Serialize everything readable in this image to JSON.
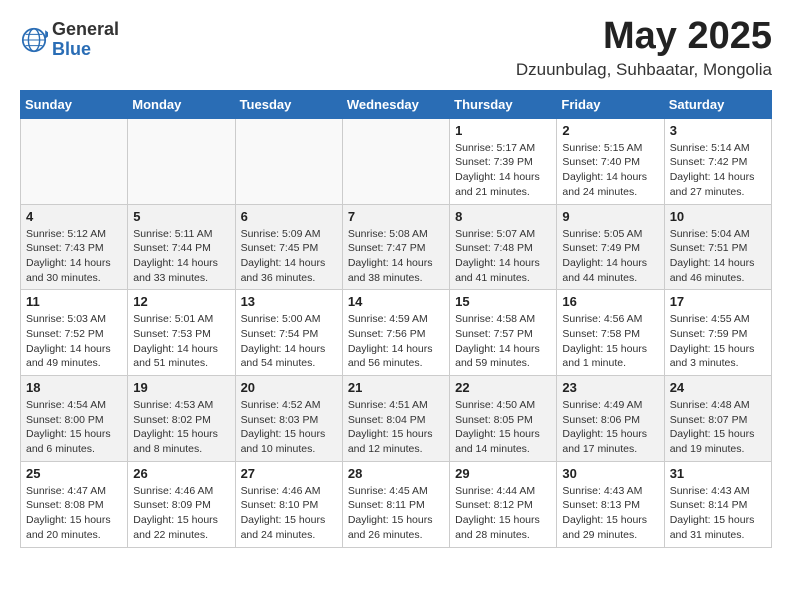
{
  "logo": {
    "general": "General",
    "blue": "Blue"
  },
  "title": "May 2025",
  "location": "Dzuunbulag, Suhbaatar, Mongolia",
  "days_of_week": [
    "Sunday",
    "Monday",
    "Tuesday",
    "Wednesday",
    "Thursday",
    "Friday",
    "Saturday"
  ],
  "weeks": [
    [
      {
        "day": "",
        "info": ""
      },
      {
        "day": "",
        "info": ""
      },
      {
        "day": "",
        "info": ""
      },
      {
        "day": "",
        "info": ""
      },
      {
        "day": "1",
        "info": "Sunrise: 5:17 AM\nSunset: 7:39 PM\nDaylight: 14 hours\nand 21 minutes."
      },
      {
        "day": "2",
        "info": "Sunrise: 5:15 AM\nSunset: 7:40 PM\nDaylight: 14 hours\nand 24 minutes."
      },
      {
        "day": "3",
        "info": "Sunrise: 5:14 AM\nSunset: 7:42 PM\nDaylight: 14 hours\nand 27 minutes."
      }
    ],
    [
      {
        "day": "4",
        "info": "Sunrise: 5:12 AM\nSunset: 7:43 PM\nDaylight: 14 hours\nand 30 minutes."
      },
      {
        "day": "5",
        "info": "Sunrise: 5:11 AM\nSunset: 7:44 PM\nDaylight: 14 hours\nand 33 minutes."
      },
      {
        "day": "6",
        "info": "Sunrise: 5:09 AM\nSunset: 7:45 PM\nDaylight: 14 hours\nand 36 minutes."
      },
      {
        "day": "7",
        "info": "Sunrise: 5:08 AM\nSunset: 7:47 PM\nDaylight: 14 hours\nand 38 minutes."
      },
      {
        "day": "8",
        "info": "Sunrise: 5:07 AM\nSunset: 7:48 PM\nDaylight: 14 hours\nand 41 minutes."
      },
      {
        "day": "9",
        "info": "Sunrise: 5:05 AM\nSunset: 7:49 PM\nDaylight: 14 hours\nand 44 minutes."
      },
      {
        "day": "10",
        "info": "Sunrise: 5:04 AM\nSunset: 7:51 PM\nDaylight: 14 hours\nand 46 minutes."
      }
    ],
    [
      {
        "day": "11",
        "info": "Sunrise: 5:03 AM\nSunset: 7:52 PM\nDaylight: 14 hours\nand 49 minutes."
      },
      {
        "day": "12",
        "info": "Sunrise: 5:01 AM\nSunset: 7:53 PM\nDaylight: 14 hours\nand 51 minutes."
      },
      {
        "day": "13",
        "info": "Sunrise: 5:00 AM\nSunset: 7:54 PM\nDaylight: 14 hours\nand 54 minutes."
      },
      {
        "day": "14",
        "info": "Sunrise: 4:59 AM\nSunset: 7:56 PM\nDaylight: 14 hours\nand 56 minutes."
      },
      {
        "day": "15",
        "info": "Sunrise: 4:58 AM\nSunset: 7:57 PM\nDaylight: 14 hours\nand 59 minutes."
      },
      {
        "day": "16",
        "info": "Sunrise: 4:56 AM\nSunset: 7:58 PM\nDaylight: 15 hours\nand 1 minute."
      },
      {
        "day": "17",
        "info": "Sunrise: 4:55 AM\nSunset: 7:59 PM\nDaylight: 15 hours\nand 3 minutes."
      }
    ],
    [
      {
        "day": "18",
        "info": "Sunrise: 4:54 AM\nSunset: 8:00 PM\nDaylight: 15 hours\nand 6 minutes."
      },
      {
        "day": "19",
        "info": "Sunrise: 4:53 AM\nSunset: 8:02 PM\nDaylight: 15 hours\nand 8 minutes."
      },
      {
        "day": "20",
        "info": "Sunrise: 4:52 AM\nSunset: 8:03 PM\nDaylight: 15 hours\nand 10 minutes."
      },
      {
        "day": "21",
        "info": "Sunrise: 4:51 AM\nSunset: 8:04 PM\nDaylight: 15 hours\nand 12 minutes."
      },
      {
        "day": "22",
        "info": "Sunrise: 4:50 AM\nSunset: 8:05 PM\nDaylight: 15 hours\nand 14 minutes."
      },
      {
        "day": "23",
        "info": "Sunrise: 4:49 AM\nSunset: 8:06 PM\nDaylight: 15 hours\nand 17 minutes."
      },
      {
        "day": "24",
        "info": "Sunrise: 4:48 AM\nSunset: 8:07 PM\nDaylight: 15 hours\nand 19 minutes."
      }
    ],
    [
      {
        "day": "25",
        "info": "Sunrise: 4:47 AM\nSunset: 8:08 PM\nDaylight: 15 hours\nand 20 minutes."
      },
      {
        "day": "26",
        "info": "Sunrise: 4:46 AM\nSunset: 8:09 PM\nDaylight: 15 hours\nand 22 minutes."
      },
      {
        "day": "27",
        "info": "Sunrise: 4:46 AM\nSunset: 8:10 PM\nDaylight: 15 hours\nand 24 minutes."
      },
      {
        "day": "28",
        "info": "Sunrise: 4:45 AM\nSunset: 8:11 PM\nDaylight: 15 hours\nand 26 minutes."
      },
      {
        "day": "29",
        "info": "Sunrise: 4:44 AM\nSunset: 8:12 PM\nDaylight: 15 hours\nand 28 minutes."
      },
      {
        "day": "30",
        "info": "Sunrise: 4:43 AM\nSunset: 8:13 PM\nDaylight: 15 hours\nand 29 minutes."
      },
      {
        "day": "31",
        "info": "Sunrise: 4:43 AM\nSunset: 8:14 PM\nDaylight: 15 hours\nand 31 minutes."
      }
    ]
  ]
}
